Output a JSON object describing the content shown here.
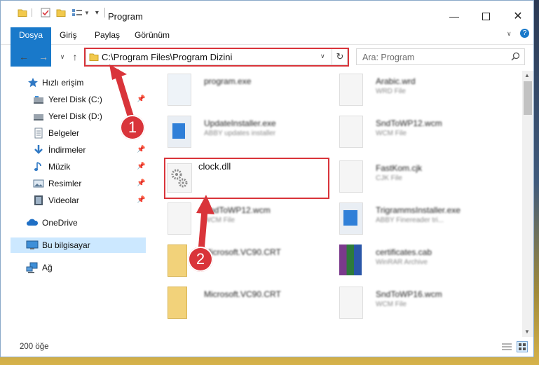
{
  "window": {
    "title": "Program"
  },
  "ribbon": {
    "tabs": [
      "Dosya",
      "Giriş",
      "Paylaş",
      "Görünüm"
    ]
  },
  "address": {
    "path": "C:\\Program Files\\Program Dizini"
  },
  "search": {
    "placeholder": "Ara: Program"
  },
  "sidebar": {
    "items": [
      {
        "label": "Hızlı erişim",
        "icon": "star-icon"
      },
      {
        "label": "Yerel Disk (C:)",
        "icon": "drive-icon"
      },
      {
        "label": "Yerel Disk (D:)",
        "icon": "drive-icon"
      },
      {
        "label": "Belgeler",
        "icon": "documents-icon"
      },
      {
        "label": "İndirmeler",
        "icon": "download-icon"
      },
      {
        "label": "Müzik",
        "icon": "music-icon"
      },
      {
        "label": "Resimler",
        "icon": "pictures-icon"
      },
      {
        "label": "Videolar",
        "icon": "videos-icon"
      },
      {
        "label": "OneDrive",
        "icon": "cloud-icon"
      },
      {
        "label": "Bu bilgisayar",
        "icon": "computer-icon"
      },
      {
        "label": "Ağ",
        "icon": "network-icon"
      }
    ]
  },
  "files": [
    {
      "name": "program.exe",
      "desc": ""
    },
    {
      "name": "Arabic.wrd",
      "desc": "WRD File"
    },
    {
      "name": "UpdateInstaller.exe",
      "desc": "ABBY updates installer"
    },
    {
      "name": "SndToWP12.wcm",
      "desc": "WCM File"
    },
    {
      "name": "clock.dll",
      "desc": ""
    },
    {
      "name": "FastKom.cjk",
      "desc": "CJK File"
    },
    {
      "name": "SndToWP12.wcm",
      "desc": "WCM File"
    },
    {
      "name": "TrigrammsInstaller.exe",
      "desc": "ABBY Finereader tri..."
    },
    {
      "name": "Microsoft.VC90.CRT",
      "desc": ""
    },
    {
      "name": "certificates.cab",
      "desc": "WinRAR Archive"
    },
    {
      "name": "Microsoft.VC90.CRT",
      "desc": ""
    },
    {
      "name": "SndToWP16.wcm",
      "desc": "WCM File"
    }
  ],
  "status": {
    "count": "200 öğe"
  },
  "annotations": {
    "badge1": "1",
    "badge2": "2"
  },
  "colors": {
    "accent": "#1979ca",
    "highlight": "#d9343a",
    "selection": "#cce8ff"
  }
}
